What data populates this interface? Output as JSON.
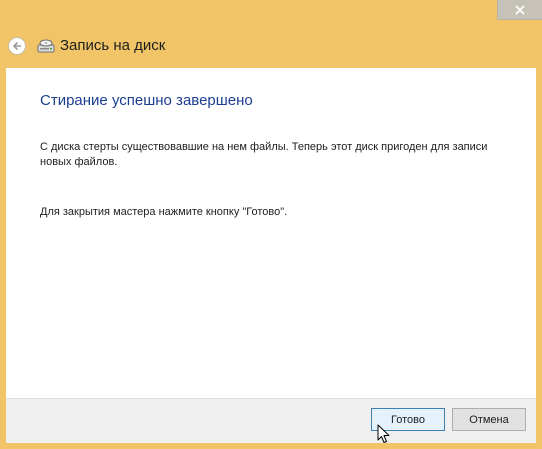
{
  "window": {
    "title": "Запись на диск",
    "frame_color": "#f1c567",
    "close_icon": "close-icon"
  },
  "nav": {
    "back_icon": "back-arrow-icon",
    "wizard_icon": "disc-burner-icon"
  },
  "content": {
    "heading": "Стирание успешно завершено",
    "message": "С диска стерты существовавшие на нем файлы. Теперь этот диск пригоден для записи новых файлов.",
    "close_instruction": "Для закрытия мастера нажмите кнопку \"Готово\"."
  },
  "footer": {
    "finish_label": "Готово",
    "cancel_label": "Отмена"
  },
  "colors": {
    "heading": "#1b3d91",
    "default_button_border": "#3c7fb1"
  }
}
